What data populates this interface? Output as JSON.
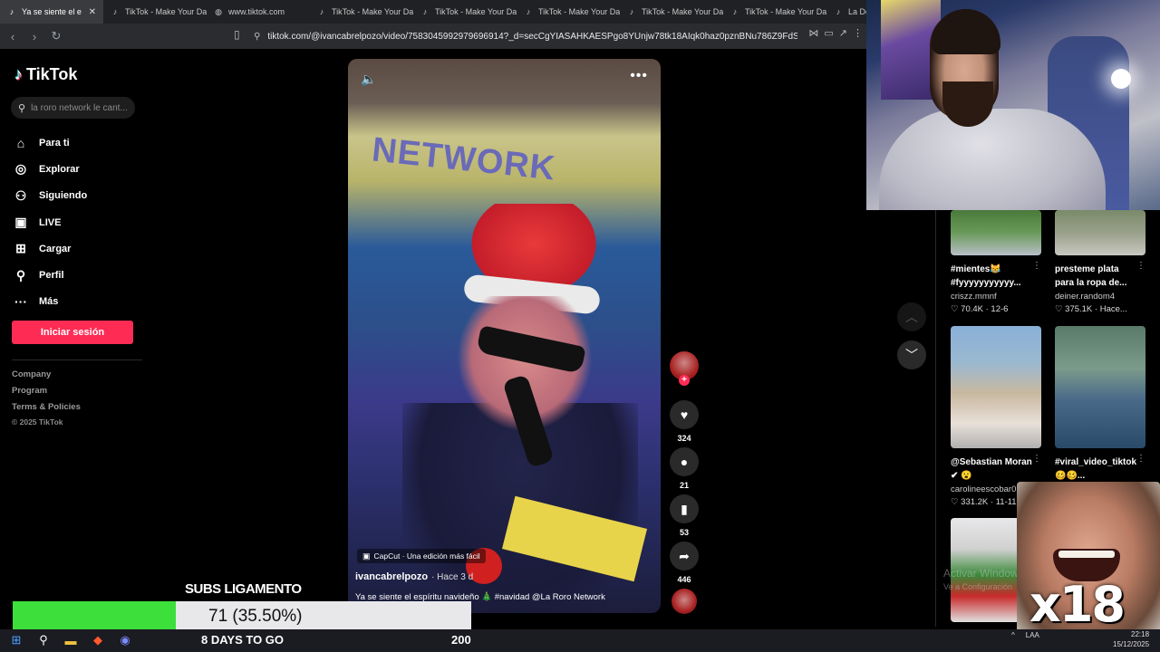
{
  "browser": {
    "tabs": [
      {
        "label": "Ya se siente el e",
        "icon": "tiktok-icon",
        "active": true
      },
      {
        "label": "TikTok - Make Your Da",
        "icon": "tiktok-icon"
      },
      {
        "label": "www.tiktok.com",
        "icon": "globe-icon"
      },
      {
        "label": "TikTok - Make Your Da",
        "icon": "tiktok-icon"
      },
      {
        "label": "TikTok - Make Your Da",
        "icon": "tiktok-icon"
      },
      {
        "label": "TikTok - Make Your Da",
        "icon": "tiktok-icon"
      },
      {
        "label": "TikTok - Make Your Da",
        "icon": "tiktok-icon"
      },
      {
        "label": "TikTok - Make Your Da",
        "icon": "tiktok-icon"
      },
      {
        "label": "La De",
        "icon": "tiktok-icon"
      }
    ],
    "url": "tiktok.com/@ivancabrelpozo/video/7583045992979696914?_d=secCgYIASAHKAESPgo8YUnjw78tk18AIqk0haz0pznBNu786Z9FdSj2Fz4aik..."
  },
  "tiktok": {
    "logo": "TikTok",
    "search_placeholder": "la roro network le cant...",
    "menu": [
      {
        "label": "Para ti",
        "icon": "home-icon"
      },
      {
        "label": "Explorar",
        "icon": "compass-icon"
      },
      {
        "label": "Siguiendo",
        "icon": "following-icon"
      },
      {
        "label": "LIVE",
        "icon": "live-icon"
      },
      {
        "label": "Cargar",
        "icon": "upload-icon"
      },
      {
        "label": "Perfil",
        "icon": "profile-icon"
      },
      {
        "label": "Más",
        "icon": "more-icon"
      }
    ],
    "login_button": "Iniciar sesión",
    "footer": [
      "Company",
      "Program",
      "Terms & Policies"
    ],
    "copyright": "© 2025 TikTok"
  },
  "video": {
    "capcut_label": "CapCut · Una edición más fácil",
    "author": "ivancabrelpozo",
    "posted": "· Hace 3 d",
    "caption": "Ya se siente el espíritu navideño 🎄 #navidad @La Roro Network",
    "likes": "324",
    "comments": "21",
    "saves": "53",
    "shares": "446"
  },
  "recommendations": [
    {
      "title": "#mientes😹 #fyyyyyyyyyyy...",
      "user": "criszz.mmnf",
      "stats": "♡ 70.4K · 12-6"
    },
    {
      "title": "presteme plata para la ropa de...",
      "user": "deiner.random4",
      "stats": "♡ 375.1K · Hace..."
    },
    {
      "title": "@Sebastian Moran ✔ 😮",
      "user": "carolineescobar0",
      "stats": "♡ 331.2K · 11-11"
    },
    {
      "title": "#viral_video_tiktok 🥴🥴...",
      "user": "",
      "stats": ""
    }
  ],
  "windows_watermark": {
    "line1": "Activar Windows",
    "line2": "Ve a Configuración"
  },
  "meme": {
    "text": "x18"
  },
  "stream": {
    "subs_title": "SUBS LIGAMENTO",
    "subs_value": "71 (35.50%)",
    "subs_progress": 0.355,
    "days_to_go": "8 DAYS TO GO",
    "goal": "200"
  },
  "taskbar": {
    "lang": "LAA",
    "time": "22:18",
    "date": "15/12/2025"
  },
  "colors": {
    "accent": "#fe2c55",
    "progress": "#3de03a"
  }
}
